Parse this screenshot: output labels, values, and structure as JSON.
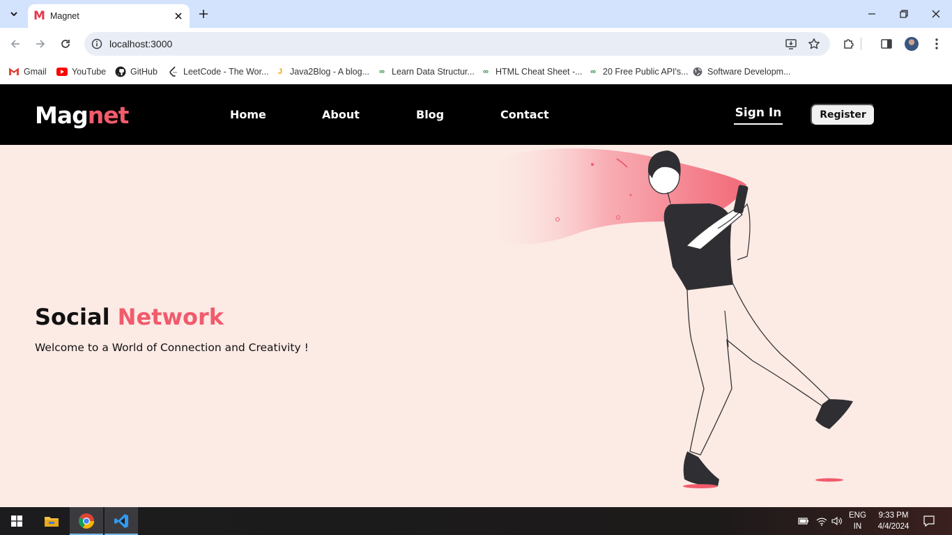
{
  "browser": {
    "tab_title": "Magnet",
    "tab_favicon": "M",
    "url": "localhost:3000",
    "bookmarks": [
      {
        "label": "Gmail",
        "icon": "gmail-icon"
      },
      {
        "label": "YouTube",
        "icon": "youtube-icon"
      },
      {
        "label": "GitHub",
        "icon": "github-icon"
      },
      {
        "label": "LeetCode - The Wor...",
        "icon": "leetcode-icon"
      },
      {
        "label": "Java2Blog - A blog...",
        "icon": "java2blog-icon"
      },
      {
        "label": "Learn Data Structur...",
        "icon": "geeksforgeeks-icon"
      },
      {
        "label": "HTML Cheat Sheet -...",
        "icon": "geeksforgeeks-icon"
      },
      {
        "label": "20 Free Public API's...",
        "icon": "geeksforgeeks-icon"
      },
      {
        "label": "Software Developm...",
        "icon": "globe-icon"
      }
    ]
  },
  "site": {
    "logo_part1": "Mag",
    "logo_part2": "net",
    "nav": [
      {
        "label": "Home"
      },
      {
        "label": "About"
      },
      {
        "label": "Blog"
      },
      {
        "label": "Contact"
      }
    ],
    "signin_label": "Sign In",
    "register_label": "Register",
    "hero": {
      "title_part1": "Social",
      "title_part2": "Network",
      "subtitle": "Welcome to a World of Connection and Creativity !"
    }
  },
  "taskbar": {
    "lang_line1": "ENG",
    "lang_line2": "IN",
    "time": "9:33 PM",
    "date": "4/4/2024"
  },
  "colors": {
    "accent": "#f15b6c",
    "hero_bg": "#fceae5",
    "nav_bg": "#000000",
    "tabstrip_bg": "#d3e3fd"
  }
}
